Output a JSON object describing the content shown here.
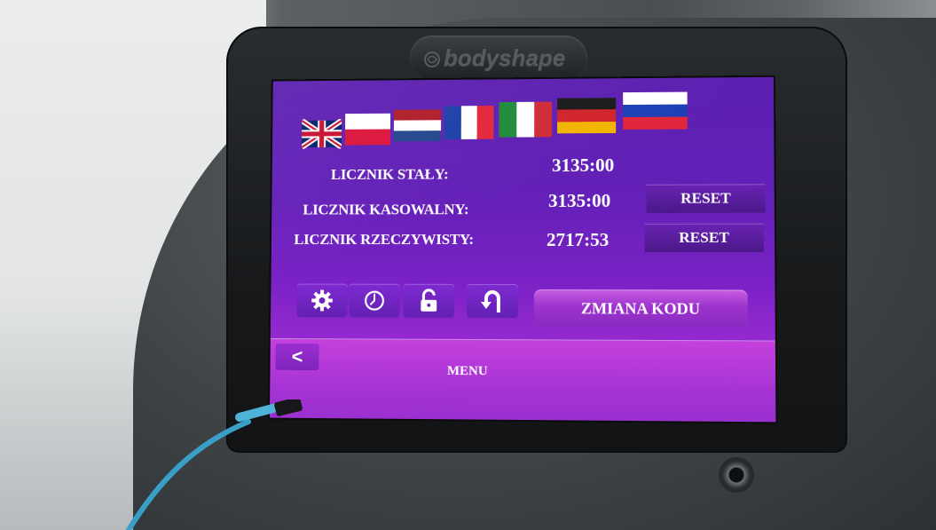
{
  "brand": {
    "logo_text": "bodyshape"
  },
  "languages": [
    {
      "code": "en",
      "icon": "uk-flag-icon"
    },
    {
      "code": "pl",
      "icon": "poland-flag-icon"
    },
    {
      "code": "nl",
      "icon": "netherlands-flag-icon"
    },
    {
      "code": "fr",
      "icon": "france-flag-icon"
    },
    {
      "code": "it",
      "icon": "italy-flag-icon"
    },
    {
      "code": "de",
      "icon": "germany-flag-icon"
    },
    {
      "code": "ru",
      "icon": "russia-flag-icon"
    }
  ],
  "counters": {
    "fixed": {
      "label": "LICZNIK STAŁY:",
      "value": "3135:00"
    },
    "resettable": {
      "label": "LICZNIK KASOWALNY:",
      "value": "3135:00",
      "button": "RESET"
    },
    "actual": {
      "label": "LICZNIK RZECZYWISTY:",
      "value": "2717:53",
      "button": "RESET"
    }
  },
  "toolbar": {
    "icons": [
      "gear-icon",
      "clock-icon",
      "unlock-icon",
      "undo-arrow-icon"
    ],
    "change_code_label": "ZMIANA KODU"
  },
  "footer": {
    "back_label": "<",
    "menu_label": "MENU"
  },
  "colors": {
    "screen_top": "#5b1fb0",
    "screen_bottom": "#b235d8",
    "button_dark": "#4a1888",
    "text": "#ffffff"
  }
}
